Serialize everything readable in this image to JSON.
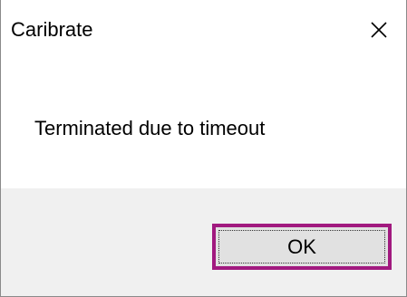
{
  "window": {
    "title": "Caribrate",
    "close_icon": "close-x-icon"
  },
  "dialog": {
    "message": "Terminated due to timeout"
  },
  "buttons": {
    "ok_label": "OK"
  },
  "colors": {
    "footer_background": "#f0f0f0",
    "button_focus_border": "#a1197f",
    "button_background": "#e1e1e1"
  }
}
